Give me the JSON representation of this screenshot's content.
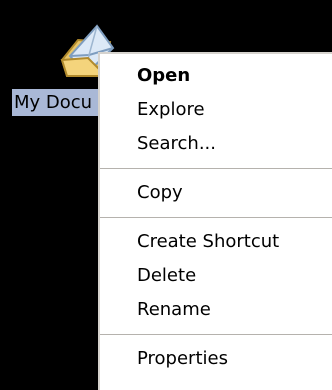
{
  "desktop": {
    "icon_name": "my-documents-folder-icon",
    "label": "My Documents",
    "label_visible_text": "My Docu"
  },
  "context_menu": {
    "open": "Open",
    "explore": "Explore",
    "search": "Search...",
    "copy": "Copy",
    "create_shortcut": "Create Shortcut",
    "delete": "Delete",
    "rename": "Rename",
    "properties": "Properties"
  },
  "colors": {
    "desktop_background": "#000000",
    "label_selection": "#a9b8d6",
    "menu_background": "#ffffff",
    "menu_separator": "#b5b2ad"
  }
}
